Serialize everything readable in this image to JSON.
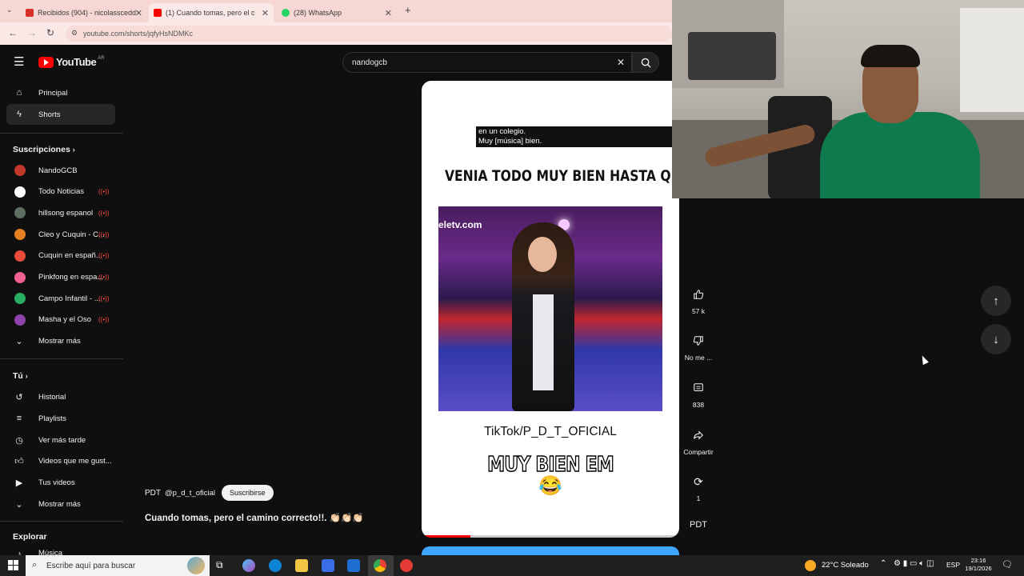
{
  "browser": {
    "tabs": [
      {
        "label": "Recibidos (904) - nicolasscedd",
        "icon": "gmail-icon"
      },
      {
        "label": "(1) Cuando tomas, pero el c",
        "icon": "youtube-icon"
      },
      {
        "label": "(28) WhatsApp",
        "icon": "whatsapp-icon"
      }
    ],
    "new_tab": "+",
    "url": "youtube.com/shorts/jqfyHsNDMKc"
  },
  "youtube": {
    "logo": "YouTube",
    "country": "AR",
    "search_value": "nandogcb"
  },
  "sidebar": {
    "main": [
      {
        "label": "Principal",
        "icon": "home-icon"
      },
      {
        "label": "Shorts",
        "icon": "shorts-icon"
      }
    ],
    "subs_title": "Suscripciones",
    "subs": [
      {
        "label": "NandoGCB",
        "live": "",
        "color": "#c0392b"
      },
      {
        "label": "Todo Noticias",
        "live": "((•))",
        "color": "#ffffff"
      },
      {
        "label": "hillsong espanol",
        "live": "((•))",
        "color": "#5d6d5f"
      },
      {
        "label": "Cleo y Cuquin - C...",
        "live": "((•))",
        "color": "#e67e22"
      },
      {
        "label": "Cuquin en españ...",
        "live": "((•))",
        "color": "#e74c3c"
      },
      {
        "label": "Pinkfong en espa...",
        "live": "((•))",
        "color": "#f06292"
      },
      {
        "label": "Campo Infantil - ...",
        "live": "((•))",
        "color": "#27ae60"
      },
      {
        "label": "Masha y el Oso",
        "live": "((•))",
        "color": "#8e44ad"
      }
    ],
    "show_more": "Mostrar más",
    "you_title": "Tú",
    "you": [
      {
        "label": "Historial",
        "icon": "history-icon"
      },
      {
        "label": "Playlists",
        "icon": "playlist-icon"
      },
      {
        "label": "Ver más tarde",
        "icon": "clock-icon"
      },
      {
        "label": "Videos que me gust...",
        "icon": "like-icon"
      },
      {
        "label": "Tus videos",
        "icon": "video-icon"
      }
    ],
    "show_more_2": "Mostrar más",
    "explore_title": "Explorar",
    "explore_partial": "Música"
  },
  "short": {
    "caption_line1": "en un colegio.",
    "caption_line2": "Muy [música] bien.",
    "headline": "VENIA TODO MUY BIEN HASTA QUE...",
    "watermark": "eletv.com",
    "credit": "TikTok/P_D_T_OFICIAL",
    "subtitle": "MUY BIEN EM",
    "emoji": "😂",
    "progress": 0.19
  },
  "channel": {
    "name": "PDT",
    "handle": "@p_d_t_oficial",
    "subscribe": "Suscribirse",
    "title": "Cuando tomas, pero el camino correcto!!. 👏🏻👏🏻👏🏻"
  },
  "actions": {
    "likes": "57 k",
    "dislike": "No me ...",
    "comments": "838",
    "share": "Compartir",
    "remix": "1",
    "avatar": "PDT"
  },
  "taskbar": {
    "search_placeholder": "Escribe aquí para buscar",
    "weather": "22°C Soleado",
    "lang": "ESP",
    "time": "23:16",
    "date": "19/1/2026"
  }
}
